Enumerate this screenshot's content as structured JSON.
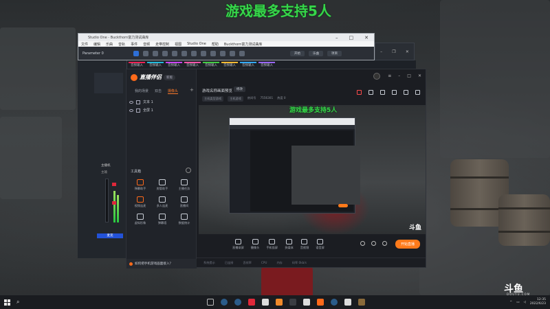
{
  "overlay": {
    "promo_text": "游戏最多支持5人"
  },
  "studio_one": {
    "title": "Studio One - Buckthorn富力测试曲库",
    "menu": [
      "文件",
      "编辑",
      "乐曲",
      "音轨",
      "事件",
      "音频",
      "走带控制",
      "视图",
      "Studio One",
      "帮助",
      "Buckthorn富力测试曲库"
    ],
    "track_label": "Parameter 0",
    "toolbar_buttons": [
      "开始",
      "乐曲",
      "项目"
    ]
  },
  "tracks": [
    "音频输入",
    "音频输入",
    "音频输入",
    "音频输入",
    "音频输入",
    "音频输入",
    "音频输入",
    "音频输入"
  ],
  "mixer": {
    "channel_name": "主播机",
    "button_label": "麦克",
    "out_label": "主输"
  },
  "douyu": {
    "brand": "直播伴侣",
    "version": "新版",
    "tabs": [
      "我的场景",
      "双击",
      "摄像头"
    ],
    "active_tab_index": 2,
    "sources": [
      {
        "label": "文本 1"
      },
      {
        "label": "全屏 1"
      }
    ],
    "tools_heading": "工具箱",
    "tools": [
      {
        "label": "弹幕助手",
        "accent": true
      },
      {
        "label": "房管助手",
        "accent": false
      },
      {
        "label": "主播任务",
        "accent": false
      },
      {
        "label": "视频连麦",
        "accent": true
      },
      {
        "label": "多人连麦",
        "accent": false
      },
      {
        "label": "直播间",
        "accent": false
      },
      {
        "label": "虚拟形象",
        "accent": false
      },
      {
        "label": "弹幕墙",
        "accent": false
      },
      {
        "label": "数据统计",
        "accent": false
      }
    ],
    "room_title": "游戏名称画面预览",
    "room_btn": "修改",
    "room_sub": [
      "主机类型游戏",
      "主机游戏",
      "房间号",
      "7556301",
      "热度 0"
    ],
    "bottom_tools": [
      "直播录屏",
      "摄像头",
      "手机投屏",
      "多媒体",
      "音视频",
      "语音屏"
    ],
    "live_button": "开始直播",
    "status": [
      "系统提示",
      "已连接",
      "丢帧率",
      "CPU",
      "内存",
      "码率 0kb/s"
    ],
    "tip": "如何把手机游戏画面接入？",
    "preview_watermark": "斗鱼"
  },
  "taskbar": {
    "time": "12:35",
    "date": "2022/6/23"
  },
  "corner_logo": {
    "text": "斗鱼",
    "sub": "DOUYU.COM"
  },
  "colors": {
    "accent": "#ff6a1a",
    "promo_green": "#36d64a",
    "studio_blue": "#2e6fd6"
  }
}
